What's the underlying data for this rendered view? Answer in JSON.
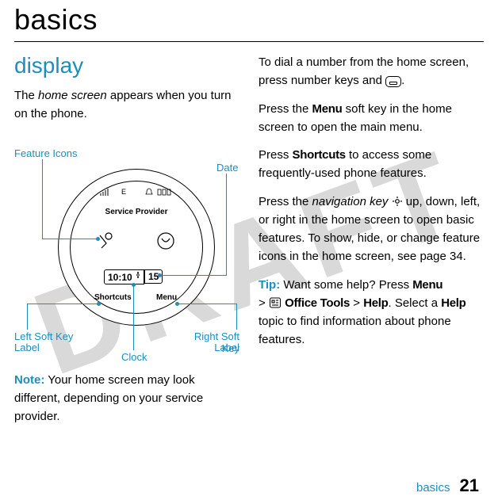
{
  "watermark": "DRAFT",
  "title": "basics",
  "footer": {
    "section": "basics",
    "page": "21"
  },
  "left": {
    "heading": "display",
    "intro_before": "The ",
    "intro_ital": "home screen",
    "intro_after": " appears when you turn on the phone.",
    "labels": {
      "feature": "Feature Icons",
      "date": "Date",
      "lsk1": "Left Soft Key",
      "lsk2": "Label",
      "rsk1": "Right Soft Key",
      "rsk2": "Label",
      "clock": "Clock"
    },
    "screen": {
      "sp": "Service Provider",
      "shortcuts": "Shortcuts",
      "menu": "Menu",
      "clock": "10:10",
      "date": "15"
    },
    "note_label": "Note:",
    "note_text": " Your home screen may look different, depending on your service provider."
  },
  "right": {
    "p1_before": "To dial a number from the home screen, press number keys and ",
    "p1_after": ".",
    "p2_before": "Press the ",
    "p2_menu": "Menu",
    "p2_after": " soft key in the home screen to open the main menu.",
    "p3_before": "Press ",
    "p3_shortcuts": "Shortcuts",
    "p3_after": " to access some frequently-used phone features.",
    "p4_before": "Press the ",
    "p4_ital": "navigation key",
    "p4_after": " up, down, left, or right in the home screen to open basic features. To show, hide, or change feature icons in the home screen, see page 34.",
    "p5_tip": "Tip:",
    "p5_a": " Want some help? Press ",
    "p5_menu": "Menu",
    "p5_b": " > ",
    "p5_office": "Office Tools",
    "p5_c": " > ",
    "p5_help1": "Help",
    "p5_d": ". Select a ",
    "p5_help2": "Help",
    "p5_e": " topic to find information about phone features."
  }
}
